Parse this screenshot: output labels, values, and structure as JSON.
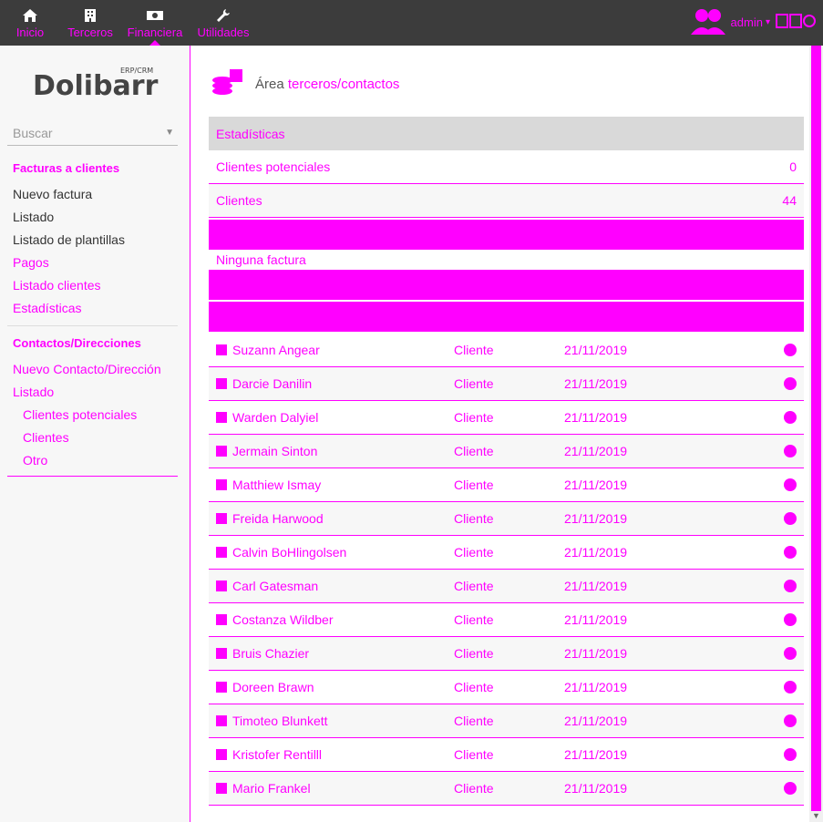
{
  "topnav": {
    "tabs": [
      {
        "label": "Inicio",
        "icon": "home-icon"
      },
      {
        "label": "Terceros",
        "icon": "building-icon"
      },
      {
        "label": "Financiera",
        "icon": "money-icon"
      },
      {
        "label": "Utilidades",
        "icon": "wrench-icon"
      }
    ],
    "user": "admin"
  },
  "sidebar": {
    "search_placeholder": "Buscar",
    "section1_title": "Facturas a clientes",
    "items1": [
      {
        "label": "Nuevo factura"
      },
      {
        "label": "Listado"
      },
      {
        "label": "Listado de plantillas"
      },
      {
        "label": "Pagos"
      },
      {
        "label": "Listado clientes"
      },
      {
        "label": "Estadísticas"
      }
    ],
    "section2_title": "Contactos/Direcciones",
    "items2": [
      {
        "label": "Nuevo Contacto/Dirección"
      },
      {
        "label": "Listado"
      }
    ],
    "subitems2": [
      {
        "label": "Clientes potenciales"
      },
      {
        "label": "Clientes"
      },
      {
        "label": "Otro"
      }
    ]
  },
  "main": {
    "title_prefix": "Área",
    "title": "terceros/contactos",
    "stats_header": "Estadísticas",
    "stats": [
      {
        "label": "Clientes potenciales",
        "value": "0"
      },
      {
        "label": "Clientes",
        "value": "44"
      }
    ],
    "no_invoice": "Ninguna factura",
    "rows": [
      {
        "name": "Suzann Angear",
        "type": "Cliente",
        "date": "21/11/2019"
      },
      {
        "name": "Darcie Danilin",
        "type": "Cliente",
        "date": "21/11/2019"
      },
      {
        "name": "Warden Dalyiel",
        "type": "Cliente",
        "date": "21/11/2019"
      },
      {
        "name": "Jermain Sinton",
        "type": "Cliente",
        "date": "21/11/2019"
      },
      {
        "name": "Matthiew Ismay",
        "type": "Cliente",
        "date": "21/11/2019"
      },
      {
        "name": "Freida Harwood",
        "type": "Cliente",
        "date": "21/11/2019"
      },
      {
        "name": "Calvin BoHlingolsen",
        "type": "Cliente",
        "date": "21/11/2019"
      },
      {
        "name": "Carl Gatesman",
        "type": "Cliente",
        "date": "21/11/2019"
      },
      {
        "name": "Costanza Wildber",
        "type": "Cliente",
        "date": "21/11/2019"
      },
      {
        "name": "Bruis Chazier",
        "type": "Cliente",
        "date": "21/11/2019"
      },
      {
        "name": "Doreen Brawn",
        "type": "Cliente",
        "date": "21/11/2019"
      },
      {
        "name": "Timoteo Blunkett",
        "type": "Cliente",
        "date": "21/11/2019"
      },
      {
        "name": "Kristofer Rentilll",
        "type": "Cliente",
        "date": "21/11/2019"
      },
      {
        "name": "Mario Frankel",
        "type": "Cliente",
        "date": "21/11/2019"
      }
    ]
  },
  "colors": {
    "accent": "#ff00ff",
    "topbar": "#3c3c3c"
  }
}
